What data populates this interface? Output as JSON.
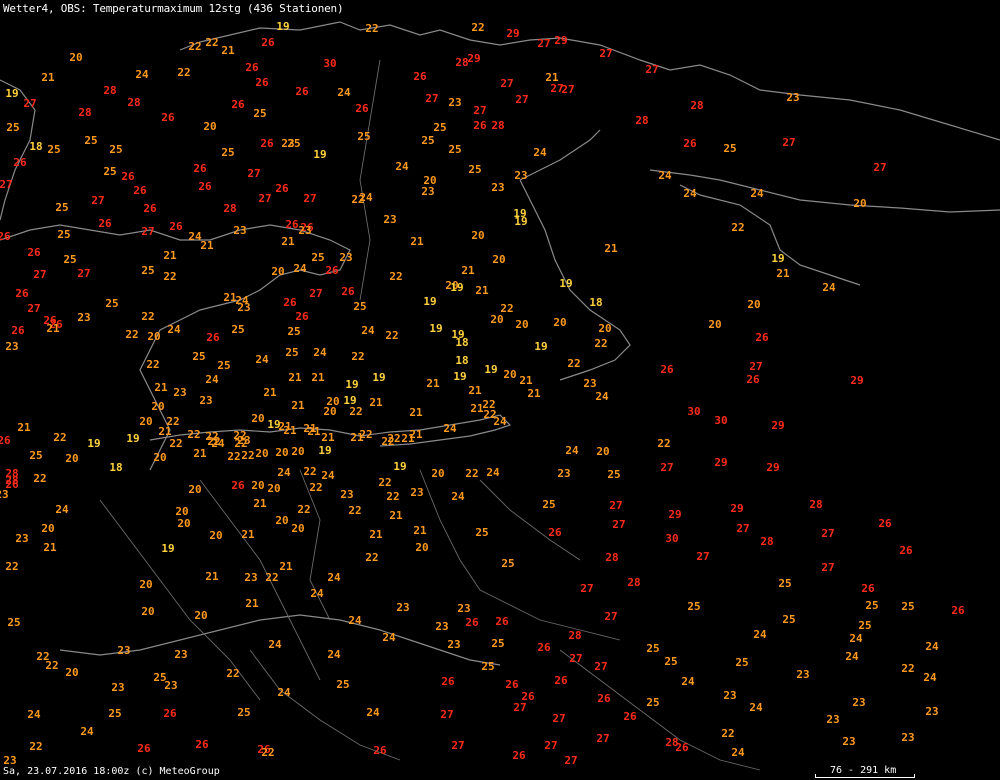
{
  "header": {
    "title": "Wetter4, OBS: Temperaturmaximum 12stg (436 Stationen)"
  },
  "footer": {
    "text": "Sa, 23.07.2016 18:00z (c) MeteoGroup"
  },
  "scale": {
    "label": "76 - 291 km"
  },
  "colors": {
    "background": "#000000",
    "coast": "#8a8a8a",
    "border": "#6a6a6a",
    "text": "#ffffff",
    "cool": "#ffd23c",
    "mild": "#ff9a1e",
    "warm": "#ff2a1a"
  },
  "temperature_unit": "°C",
  "stations_count": 436
}
